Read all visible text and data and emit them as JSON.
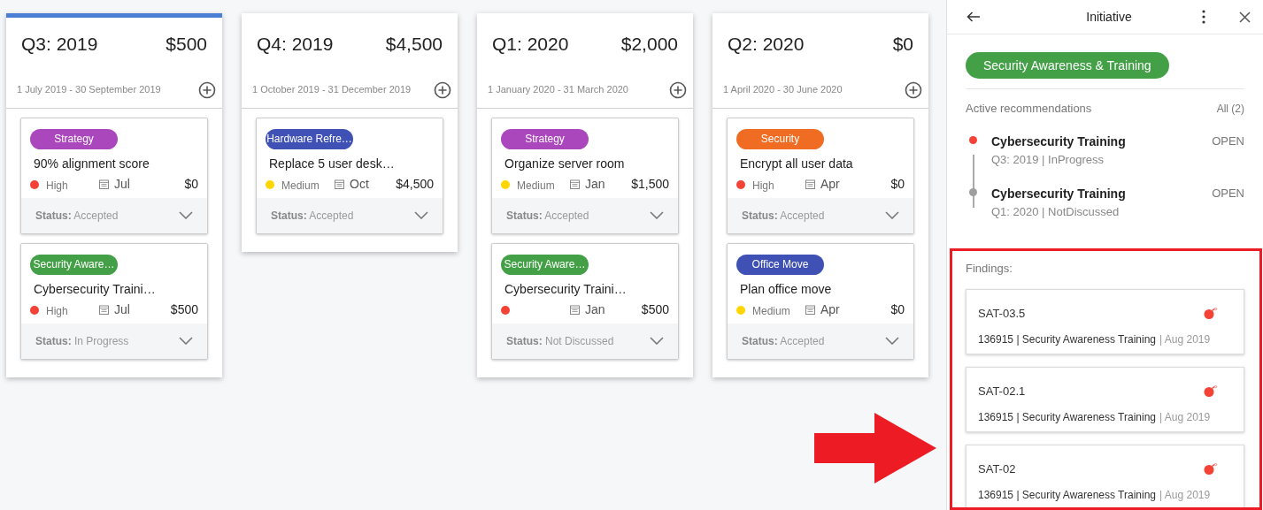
{
  "columns": [
    {
      "title": "Q3: 2019",
      "total": "$500",
      "dates": "1 July 2019 - 30 September 2019",
      "selected": true,
      "cards": [
        {
          "tag": {
            "label": "Strategy",
            "color": "#ab47bc"
          },
          "title": "90% alignment score",
          "priority": "High",
          "color": "#f44336",
          "month": "Jul",
          "amount": "$0",
          "status_label": "Status:",
          "status": "Accepted"
        },
        {
          "tag": {
            "label": "Security Aware…",
            "color": "#43a047"
          },
          "title": "Cybersecurity Traini…",
          "priority": "High",
          "color": "#f44336",
          "month": "Jul",
          "amount": "$500",
          "status_label": "Status:",
          "status": "In Progress"
        }
      ]
    },
    {
      "title": "Q4: 2019",
      "total": "$4,500",
      "dates": "1 October 2019 - 31 December 2019",
      "selected": false,
      "cards": [
        {
          "tag": {
            "label": "Hardware Refre…",
            "color": "#3f51b5"
          },
          "title": "Replace 5 user desk…",
          "priority": "Medium",
          "color": "#ffd600",
          "month": "Oct",
          "amount": "$4,500",
          "status_label": "Status:",
          "status": "Accepted"
        }
      ]
    },
    {
      "title": "Q1: 2020",
      "total": "$2,000",
      "dates": "1 January 2020 - 31 March 2020",
      "selected": false,
      "cards": [
        {
          "tag": {
            "label": "Strategy",
            "color": "#ab47bc"
          },
          "title": "Organize server room",
          "priority": "Medium",
          "color": "#ffd600",
          "month": "Jan",
          "amount": "$1,500",
          "status_label": "Status:",
          "status": "Accepted"
        },
        {
          "tag": {
            "label": "Security Aware…",
            "color": "#43a047"
          },
          "title": "Cybersecurity Traini…",
          "color": "#f44336",
          "month": "Jan",
          "amount": "$500",
          "status_label": "Status:",
          "status": "Not Discussed"
        }
      ]
    },
    {
      "title": "Q2: 2020",
      "total": "$0",
      "dates": "1 April 2020 - 30 June 2020",
      "selected": false,
      "cards": [
        {
          "tag": {
            "label": "Security",
            "color": "#ef6c22"
          },
          "title": "Encrypt all user data",
          "priority": "High",
          "color": "#f44336",
          "month": "Apr",
          "amount": "$0",
          "status_label": "Status:",
          "status": "Accepted"
        },
        {
          "tag": {
            "label": "Office Move",
            "color": "#3f51b5"
          },
          "title": "Plan office move",
          "priority": "Medium",
          "color": "#ffd600",
          "month": "Apr",
          "amount": "$0",
          "status_label": "Status:",
          "status": "Accepted"
        }
      ]
    }
  ],
  "panel": {
    "title": "Initiative",
    "chip": "Security Awareness & Training",
    "recommendations_label": "Active recommendations",
    "all_link": "All (2)",
    "recommendations": [
      {
        "title": "Cybersecurity Training",
        "meta": "Q3: 2019 | InProgress",
        "badge": "OPEN",
        "color": "#f44336"
      },
      {
        "title": "Cybersecurity Training",
        "meta": "Q1: 2020 | NotDiscussed",
        "badge": "OPEN",
        "color": "#9e9e9e"
      }
    ],
    "findings_label": "Findings:",
    "findings": [
      {
        "code": "SAT-03.5",
        "details": "136915 | Security Awareness Training",
        "date": "| Aug 2019"
      },
      {
        "code": "SAT-02.1",
        "details": "136915 | Security Awareness Training",
        "date": "| Aug 2019"
      },
      {
        "code": "SAT-02",
        "details": "136915 | Security Awareness Training",
        "date": "| Aug 2019"
      }
    ]
  }
}
